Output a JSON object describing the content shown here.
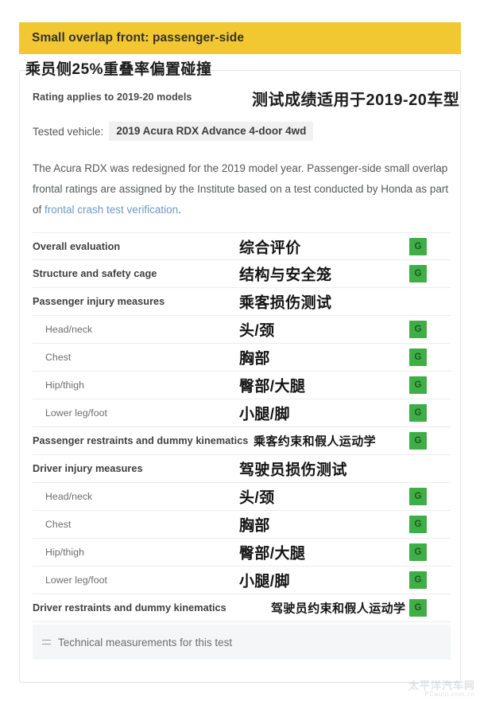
{
  "header": {
    "title": "Small overlap front: passenger-side",
    "bar_color": "#f2c832"
  },
  "subtitle_cn": "乘员侧25%重叠率偏置碰撞",
  "applies": {
    "en": "Rating applies to 2019-20 models",
    "cn": "测试成绩适用于2019-20车型"
  },
  "vehicle": {
    "label": "Tested vehicle:",
    "value": "2019 Acura RDX Advance 4-door 4wd"
  },
  "description": {
    "part1": "The Acura RDX was redesigned for the 2019 model year. Passenger-side small overlap frontal ratings are assigned by the Institute based on a test conducted by Honda as part of ",
    "link": "frontal crash test verification",
    "part2": "."
  },
  "ratings": {
    "badge_color": "#3fae46",
    "rows": [
      {
        "en": "Overall evaluation",
        "cn": "综合评价",
        "rating": "G",
        "level": "main"
      },
      {
        "en": "Structure and safety cage",
        "cn": "结构与安全笼",
        "rating": "G",
        "level": "main"
      },
      {
        "en": "Passenger injury measures",
        "cn": "乘客损伤测试",
        "rating": "",
        "level": "main"
      },
      {
        "en": "Head/neck",
        "cn": "头/颈",
        "rating": "G",
        "level": "sub"
      },
      {
        "en": "Chest",
        "cn": "胸部",
        "rating": "G",
        "level": "sub"
      },
      {
        "en": "Hip/thigh",
        "cn": "臀部/大腿",
        "rating": "G",
        "level": "sub"
      },
      {
        "en": "Lower leg/foot",
        "cn": "小腿/脚",
        "rating": "G",
        "level": "sub"
      },
      {
        "en": "Passenger restraints and dummy kinematics",
        "cn": "乘客约束和假人运动学",
        "rating": "G",
        "level": "wide-tight"
      },
      {
        "en": "Driver injury measures",
        "cn": "驾驶员损伤测试",
        "rating": "",
        "level": "main"
      },
      {
        "en": "Head/neck",
        "cn": "头/颈",
        "rating": "G",
        "level": "sub"
      },
      {
        "en": "Chest",
        "cn": "胸部",
        "rating": "G",
        "level": "sub"
      },
      {
        "en": "Hip/thigh",
        "cn": "臀部/大腿",
        "rating": "G",
        "level": "sub"
      },
      {
        "en": "Lower leg/foot",
        "cn": "小腿/脚",
        "rating": "G",
        "level": "sub"
      },
      {
        "en": "Driver restraints and dummy kinematics",
        "cn": "驾驶员约束和假人运动学",
        "rating": "G",
        "level": "wide"
      }
    ]
  },
  "technical": {
    "label": "Technical measurements for this test",
    "icon": "collapsed-list-icon"
  },
  "watermark": {
    "main": "太平洋汽车网",
    "sub": "PCauto.com.cn"
  }
}
